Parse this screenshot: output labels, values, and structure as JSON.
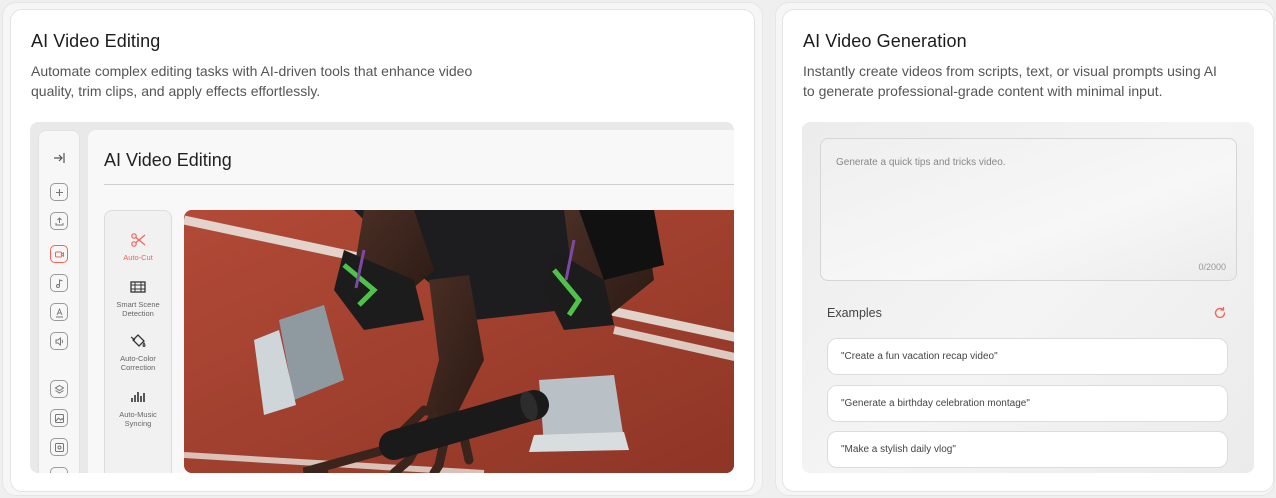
{
  "cards": {
    "editing": {
      "title": "AI Video Editing",
      "description_line1": "Automate complex editing tasks with AI-driven tools that enhance video",
      "description_line2": "quality, trim clips, and apply effects effortlessly.",
      "mock": {
        "panel_title": "AI Video Editing",
        "tools": [
          {
            "label_line1": "Auto-Cut",
            "label_line2": "",
            "icon": "scissors-icon"
          },
          {
            "label_line1": "Smart Scene",
            "label_line2": "Detection",
            "icon": "film-frame-icon"
          },
          {
            "label_line1": "Auto-Color",
            "label_line2": "Correction",
            "icon": "paint-bucket-icon"
          },
          {
            "label_line1": "Auto-Music",
            "label_line2": "Syncing",
            "icon": "equalizer-icon"
          }
        ],
        "rail_icons": [
          "collapse-sidebar-icon",
          "plus-icon",
          "upload-icon",
          "video-icon",
          "music-note-icon",
          "text-icon",
          "volume-icon",
          "layers-icon",
          "image-icon",
          "image-icon"
        ]
      }
    },
    "generation": {
      "title": "AI Video Generation",
      "description_line1": "Instantly create videos from scripts, text, or visual prompts using AI",
      "description_line2": "to generate professional-grade content with minimal input.",
      "mock": {
        "prompt_placeholder": "Generate a quick tips and tricks video.",
        "char_count": "0/2000",
        "examples_title": "Examples",
        "examples": [
          "\"Create a fun vacation recap video\"",
          "\"Generate a birthday celebration montage\"",
          "\"Make a stylish daily vlog\""
        ]
      }
    }
  },
  "colors": {
    "accent": "#f0645a",
    "track": "#a6402f",
    "card_bg": "#ffffff",
    "page_bg": "#efefef"
  }
}
